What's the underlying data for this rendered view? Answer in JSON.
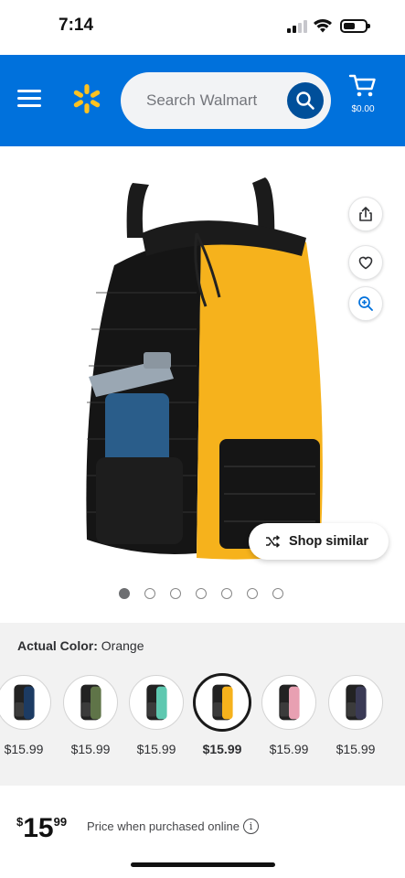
{
  "status_bar": {
    "time": "7:14"
  },
  "header": {
    "menu_icon": "hamburger-icon",
    "logo_icon": "walmart-spark-icon",
    "search_placeholder": "Search Walmart",
    "cart_amount": "$0.00",
    "brand_color": "#0071dc"
  },
  "product": {
    "image_icon": "mesh-drawstring-backpack-orange",
    "shop_similar_label": "Shop similar",
    "carousel": {
      "count": 7,
      "active_index": 0
    }
  },
  "variants": {
    "label": "Actual Color:",
    "selected_color": "Orange",
    "options": [
      {
        "color": "#1c3b63",
        "price": "$15.99",
        "selected": false
      },
      {
        "color": "#5f7448",
        "price": "$15.99",
        "selected": false
      },
      {
        "color": "#5ec8b0",
        "price": "$15.99",
        "selected": false
      },
      {
        "color": "#f6b21c",
        "price": "$15.99",
        "selected": true
      },
      {
        "color": "#e8a0b2",
        "price": "$15.99",
        "selected": false
      },
      {
        "color": "#3a3a55",
        "price": "$15.99",
        "selected": false
      }
    ]
  },
  "price": {
    "currency": "$",
    "whole": "15",
    "cents": "99",
    "note": "Price when purchased online"
  }
}
